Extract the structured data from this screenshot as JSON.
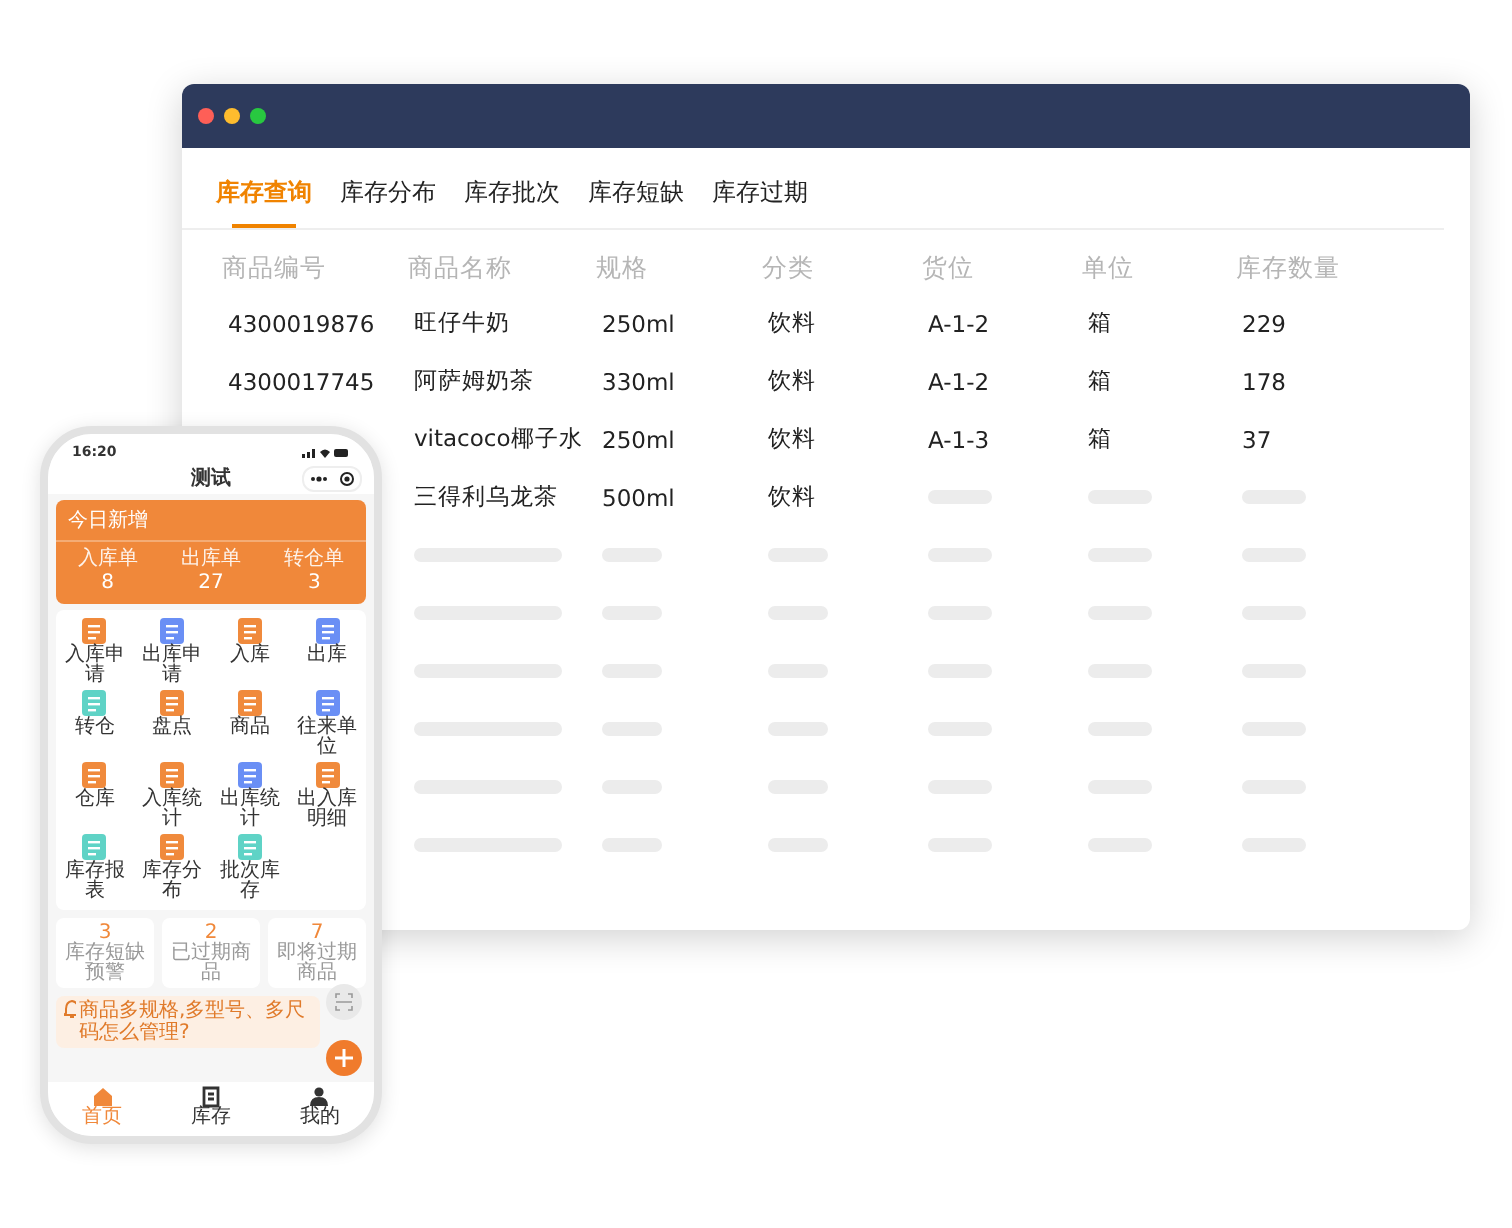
{
  "window": {
    "tabs": [
      {
        "label": "库存查询",
        "selected": true
      },
      {
        "label": "库存分布",
        "selected": false
      },
      {
        "label": "库存批次",
        "selected": false
      },
      {
        "label": "库存短缺",
        "selected": false
      },
      {
        "label": "库存过期",
        "selected": false
      }
    ],
    "table": {
      "columns": [
        "商品编号",
        "商品名称",
        "规格",
        "分类",
        "货位",
        "单位",
        "库存数量"
      ],
      "rows": [
        {
          "cells": [
            {
              "kind": "text",
              "text": "4300019876"
            },
            {
              "kind": "text",
              "text": "旺仔牛奶"
            },
            {
              "kind": "text",
              "text": "250ml"
            },
            {
              "kind": "text",
              "text": "饮料"
            },
            {
              "kind": "text",
              "text": "A-1-2"
            },
            {
              "kind": "text",
              "text": "箱"
            },
            {
              "kind": "text",
              "text": "229"
            }
          ]
        },
        {
          "cells": [
            {
              "kind": "text",
              "text": "4300017745"
            },
            {
              "kind": "text",
              "text": "阿萨姆奶茶"
            },
            {
              "kind": "text",
              "text": "330ml"
            },
            {
              "kind": "text",
              "text": "饮料"
            },
            {
              "kind": "text",
              "text": "A-1-2"
            },
            {
              "kind": "text",
              "text": "箱"
            },
            {
              "kind": "text",
              "text": "178"
            }
          ]
        },
        {
          "cells": [
            {
              "kind": "hidden"
            },
            {
              "kind": "text",
              "text": "vitacoco椰子水"
            },
            {
              "kind": "text",
              "text": "250ml"
            },
            {
              "kind": "text",
              "text": "饮料"
            },
            {
              "kind": "text",
              "text": "A-1-3"
            },
            {
              "kind": "text",
              "text": "箱"
            },
            {
              "kind": "text",
              "text": "37"
            }
          ]
        },
        {
          "cells": [
            {
              "kind": "hidden"
            },
            {
              "kind": "text",
              "text": "三得利乌龙茶"
            },
            {
              "kind": "text",
              "text": "500ml"
            },
            {
              "kind": "text",
              "text": "饮料"
            },
            {
              "kind": "placeholder"
            },
            {
              "kind": "placeholder"
            },
            {
              "kind": "placeholder"
            }
          ]
        },
        {
          "cells": [
            {
              "kind": "hidden"
            },
            {
              "kind": "placeholder"
            },
            {
              "kind": "placeholder"
            },
            {
              "kind": "placeholder"
            },
            {
              "kind": "placeholder"
            },
            {
              "kind": "placeholder"
            },
            {
              "kind": "placeholder"
            }
          ]
        },
        {
          "cells": [
            {
              "kind": "hidden"
            },
            {
              "kind": "placeholder"
            },
            {
              "kind": "placeholder"
            },
            {
              "kind": "placeholder"
            },
            {
              "kind": "placeholder"
            },
            {
              "kind": "placeholder"
            },
            {
              "kind": "placeholder"
            }
          ]
        },
        {
          "cells": [
            {
              "kind": "hidden"
            },
            {
              "kind": "placeholder"
            },
            {
              "kind": "placeholder"
            },
            {
              "kind": "placeholder"
            },
            {
              "kind": "placeholder"
            },
            {
              "kind": "placeholder"
            },
            {
              "kind": "placeholder"
            }
          ]
        },
        {
          "cells": [
            {
              "kind": "hidden"
            },
            {
              "kind": "placeholder"
            },
            {
              "kind": "placeholder"
            },
            {
              "kind": "placeholder"
            },
            {
              "kind": "placeholder"
            },
            {
              "kind": "placeholder"
            },
            {
              "kind": "placeholder"
            }
          ]
        },
        {
          "cells": [
            {
              "kind": "hidden"
            },
            {
              "kind": "placeholder"
            },
            {
              "kind": "placeholder"
            },
            {
              "kind": "placeholder"
            },
            {
              "kind": "placeholder"
            },
            {
              "kind": "placeholder"
            },
            {
              "kind": "placeholder"
            }
          ]
        },
        {
          "cells": [
            {
              "kind": "hidden"
            },
            {
              "kind": "placeholder"
            },
            {
              "kind": "placeholder"
            },
            {
              "kind": "placeholder"
            },
            {
              "kind": "placeholder"
            },
            {
              "kind": "placeholder"
            },
            {
              "kind": "placeholder"
            }
          ]
        }
      ]
    }
  },
  "phone": {
    "status_time": "16:20",
    "title": "测试",
    "today": {
      "title": "今日新增",
      "stats": [
        {
          "label": "入库单",
          "value": "8"
        },
        {
          "label": "出库单",
          "value": "27"
        },
        {
          "label": "转仓单",
          "value": "3"
        }
      ]
    },
    "apps": [
      {
        "label": "入库申请",
        "color": "#f08a3c"
      },
      {
        "label": "出库申请",
        "color": "#6a8ff5"
      },
      {
        "label": "入库",
        "color": "#f08a3c"
      },
      {
        "label": "出库",
        "color": "#6a8ff5"
      },
      {
        "label": "转仓",
        "color": "#5fd3c6"
      },
      {
        "label": "盘点",
        "color": "#f08a3c"
      },
      {
        "label": "商品",
        "color": "#f08a3c"
      },
      {
        "label": "往来单位",
        "color": "#6a8ff5"
      },
      {
        "label": "仓库",
        "color": "#f08a3c"
      },
      {
        "label": "入库统计",
        "color": "#f08a3c"
      },
      {
        "label": "出库统计",
        "color": "#6a8ff5"
      },
      {
        "label": "出入库明细",
        "color": "#f08a3c"
      },
      {
        "label": "库存报表",
        "color": "#5fd3c6"
      },
      {
        "label": "库存分布",
        "color": "#f08a3c"
      },
      {
        "label": "批次库存",
        "color": "#5fd3c6"
      }
    ],
    "alerts": [
      {
        "value": "3",
        "label": "库存短缺预警"
      },
      {
        "value": "2",
        "label": "已过期商品"
      },
      {
        "value": "7",
        "label": "即将过期商品"
      }
    ],
    "notice": "商品多规格,多型号、多尺码怎么管理?",
    "nav": [
      {
        "label": "首页",
        "selected": true
      },
      {
        "label": "库存",
        "selected": false
      },
      {
        "label": "我的",
        "selected": false
      }
    ]
  }
}
